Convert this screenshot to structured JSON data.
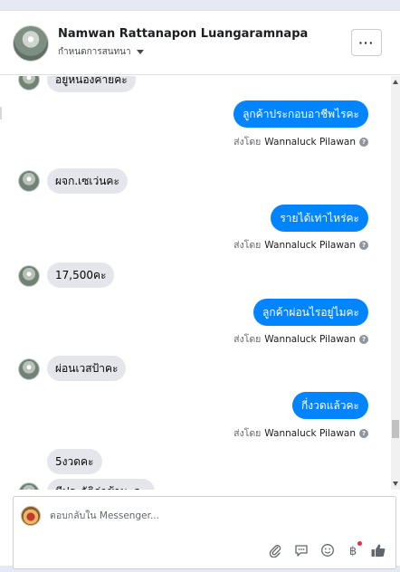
{
  "header": {
    "name": "Namwan Rattanapon Luangaramnapa",
    "subtitle": "กำหนดการสนทนา",
    "more_label": "···"
  },
  "thread": {
    "messages": [
      {
        "dir": "in",
        "text": "อยู่หน่องค่ายคะ"
      },
      {
        "dir": "out",
        "text": "ลูกค้าประกอบอาชีพไรคะ",
        "sent_by_prefix": "ส่งโดย",
        "sent_by_name": "Wannaluck Pilawan"
      },
      {
        "dir": "in",
        "text": "ผจก.เซเว่นคะ"
      },
      {
        "dir": "out",
        "text": "รายได้เท่าไหร่คะ",
        "sent_by_prefix": "ส่งโดย",
        "sent_by_name": "Wannaluck Pilawan"
      },
      {
        "dir": "in",
        "text": "17,500คะ"
      },
      {
        "dir": "out",
        "text": "ลูกค้าผ่อนไรอยู่ไมคะ",
        "sent_by_prefix": "ส่งโดย",
        "sent_by_name": "Wannaluck Pilawan"
      },
      {
        "dir": "in",
        "text": "ผ่อนเวสป้าคะ"
      },
      {
        "dir": "out",
        "text": "กี่งวดแล้วคะ",
        "sent_by_prefix": "ส่งโดย",
        "sent_by_name": "Wannaluck Pilawan"
      },
      {
        "dir": "in",
        "text": "5งวดคะ"
      },
      {
        "dir": "in",
        "text": "มีประวัติล่าช้านะคะ"
      }
    ]
  },
  "composer": {
    "placeholder": "ตอบกลับใน Messenger...",
    "tools": [
      "paperclip-icon",
      "comment-icon",
      "emoji-icon",
      "baht-icon",
      "thumbs-up-icon"
    ]
  },
  "colors": {
    "outgoing_bubble": "#0084ff",
    "incoming_bubble": "#e4e6eb",
    "like_icon": "#606770",
    "notification_dot": "#f02849"
  }
}
